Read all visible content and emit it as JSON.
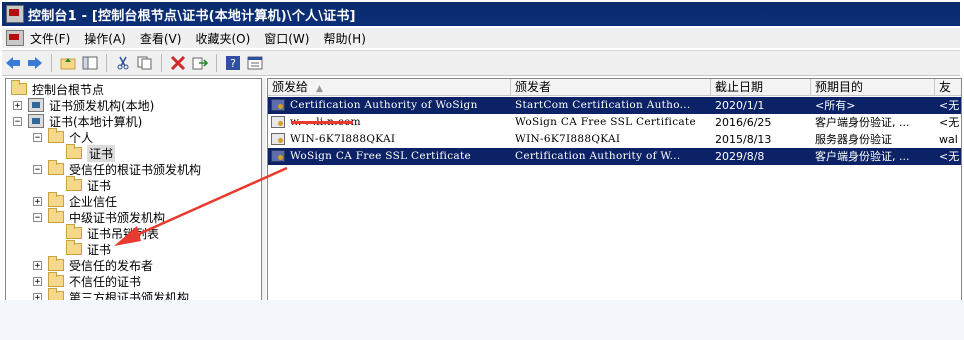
{
  "window": {
    "title": "控制台1 - [控制台根节点\\证书(本地计算机)\\个人\\证书]"
  },
  "menu": [
    "文件(F)",
    "操作(A)",
    "查看(V)",
    "收藏夹(O)",
    "窗口(W)",
    "帮助(H)"
  ],
  "toolbar": [
    "back-icon",
    "forward-icon",
    "up-folder-icon",
    "show-tree-icon",
    "cut-icon",
    "copy-icon",
    "delete-icon",
    "export-icon",
    "help-icon",
    "properties-icon"
  ],
  "tree": {
    "root": "控制台根节点",
    "ca_local": "证书颁发机构(本地)",
    "certs_local": "证书(本地计算机)",
    "personal": "个人",
    "personal_certs": "证书",
    "trusted_root": "受信任的根证书颁发机构",
    "trusted_root_certs": "证书",
    "enterprise_trust": "企业信任",
    "intermediate": "中级证书颁发机构",
    "intermediate_crl": "证书吊销列表",
    "intermediate_certs": "证书",
    "trusted_publishers": "受信任的发布者",
    "untrusted": "不信任的证书",
    "third_party_root": "第三方根证书颁发机构"
  },
  "list": {
    "columns": [
      "颁发给",
      "颁发者",
      "截止日期",
      "预期目的",
      "友"
    ],
    "rows": [
      {
        "issued_to": "Certification Authority of WoSign",
        "issued_by": "StartCom Certification Autho...",
        "expires": "2020/1/1",
        "purpose": "<所有>",
        "friendly": "<无",
        "selected": true
      },
      {
        "issued_to": "w.   .  .li.n.com",
        "issued_by": "WoSign CA Free SSL Certificate",
        "expires": "2016/6/25",
        "purpose": "客户端身份验证, ...",
        "friendly": "<无",
        "selected": false
      },
      {
        "issued_to": "WIN-6K7I888QKAI",
        "issued_by": "WIN-6K7I888QKAI",
        "expires": "2015/8/13",
        "purpose": "服务器身份验证",
        "friendly": "wal",
        "selected": false
      },
      {
        "issued_to": "WoSign CA Free SSL Certificate",
        "issued_by": "Certification Authority of W...",
        "expires": "2029/8/8",
        "purpose": "客户端身份验证, ...",
        "friendly": "<无",
        "selected": true
      }
    ]
  },
  "colors": {
    "title_bar": "#0b2f78",
    "selection": "#0b2266",
    "annotation": "#e83a2e"
  }
}
